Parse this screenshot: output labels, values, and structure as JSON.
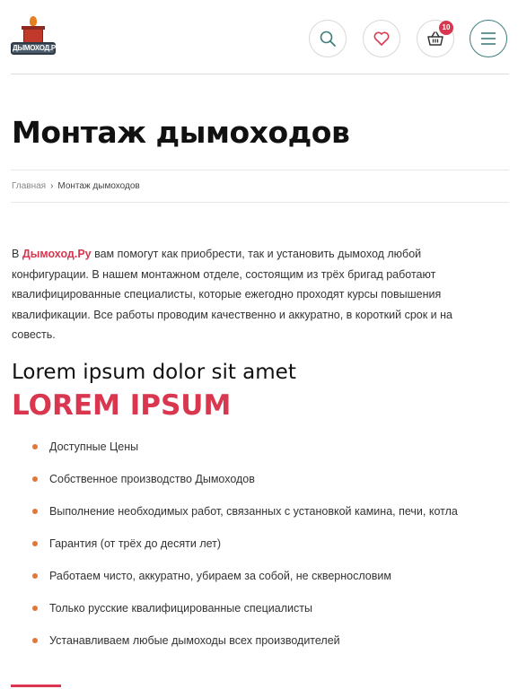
{
  "header": {
    "logo_text": "ДЫМОХОД.РУ",
    "cart_count": "10",
    "icons": [
      "search-icon",
      "heart-icon",
      "basket-icon",
      "menu-icon"
    ],
    "accent_color": "#d9364f"
  },
  "page": {
    "title": "Монтаж дымоходов",
    "breadcrumb": {
      "home": "Главная",
      "separator": "›",
      "current": "Монтаж дымоходов"
    },
    "intro": {
      "prefix": "В ",
      "brand": "Дымоход.Ру",
      "text": " вам помогут как приобрести, так и установить дымоход любой конфигурации. В нашем монтажном отделе, состоящим из трёх бригад работают квалифицированные специалисты, которые ежегодно проходят курсы повышения квалификации. Все работы проводим качественно и аккуратно, в короткий срок и на совесть."
    },
    "subtitle": "Lorem ipsum dolor sit amet",
    "accent_title": "LOREM IPSUM",
    "features": [
      "Доступные Цены",
      "Собственное производство Дымоходов",
      "Выполнение необходимых работ, связанных с установкой камина, печи, котла",
      "Гарантия (от трёх до десяти лет)",
      "Работаем чисто, аккуратно, убираем за собой, не сквернословим",
      "Только русские квалифицированные специалисты",
      "Устанавливаем любые дымоходы всех производителей"
    ]
  }
}
